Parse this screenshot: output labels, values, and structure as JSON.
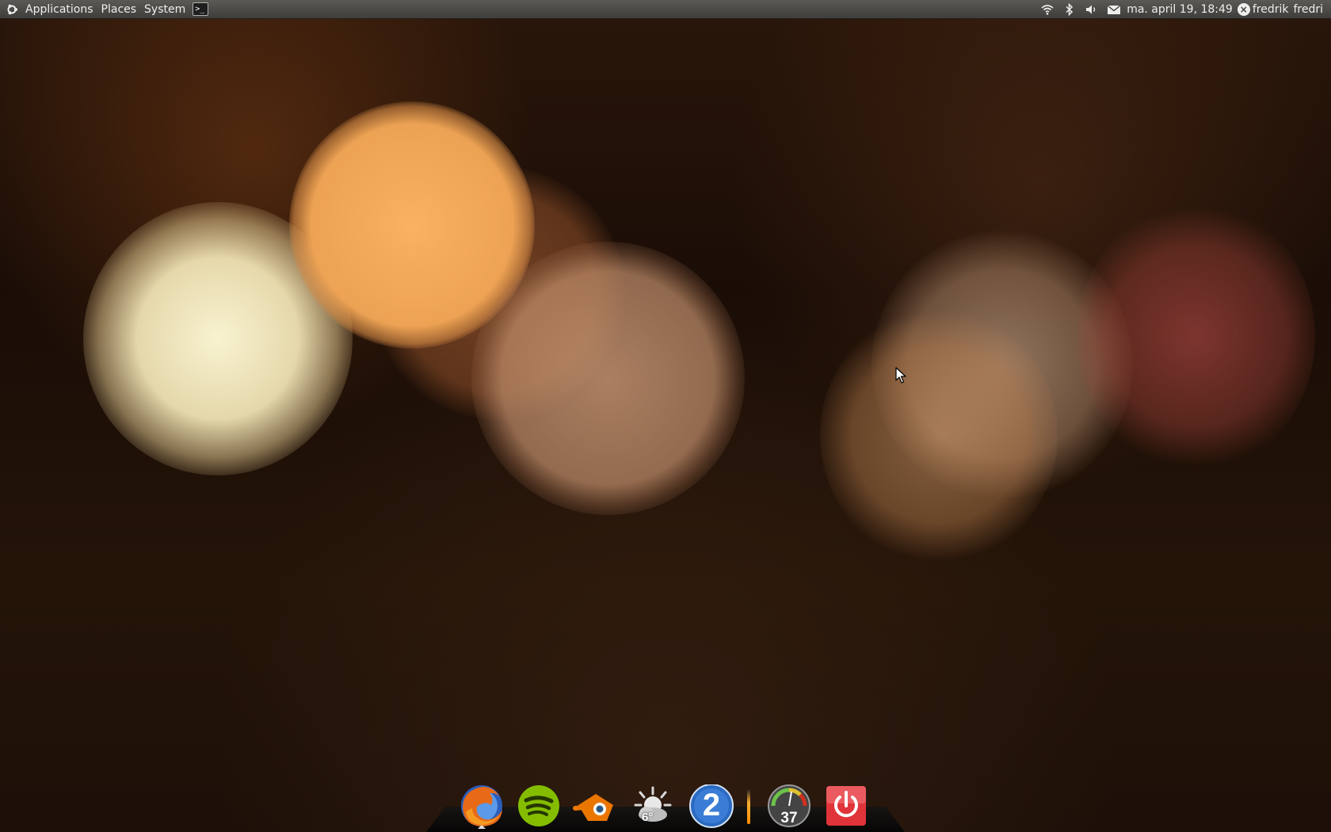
{
  "top_panel": {
    "menus": {
      "applications": "Applications",
      "places": "Places",
      "system": "System"
    },
    "terminal_label": ">_",
    "clock": "ma. april 19, 18:49",
    "users": [
      "fredrik",
      "fredri"
    ],
    "tray_icons": [
      "network-wifi-icon",
      "bluetooth-icon",
      "volume-icon",
      "mail-icon"
    ]
  },
  "dock": {
    "items": [
      {
        "name": "Firefox",
        "icon": "firefox-icon",
        "running": true
      },
      {
        "name": "Spotify",
        "icon": "spotify-icon",
        "running": false
      },
      {
        "name": "Blender",
        "icon": "blender-icon",
        "running": false
      },
      {
        "name": "Weather",
        "icon": "weather-icon",
        "running": false,
        "badge": "6°"
      },
      {
        "name": "Workspace",
        "icon": "workspace-switcher-icon",
        "running": false,
        "badge": "2"
      },
      {
        "name": "System Monitor",
        "icon": "gauge-icon",
        "running": false,
        "badge": "37"
      },
      {
        "name": "Shutdown",
        "icon": "power-icon",
        "running": false
      }
    ]
  },
  "colors": {
    "panel": "#3f3e3b",
    "panel_text": "#eeeeec",
    "spotify_green": "#84bd00",
    "power_red": "#e0343a",
    "workspace_blue": "#2a6ac0"
  }
}
